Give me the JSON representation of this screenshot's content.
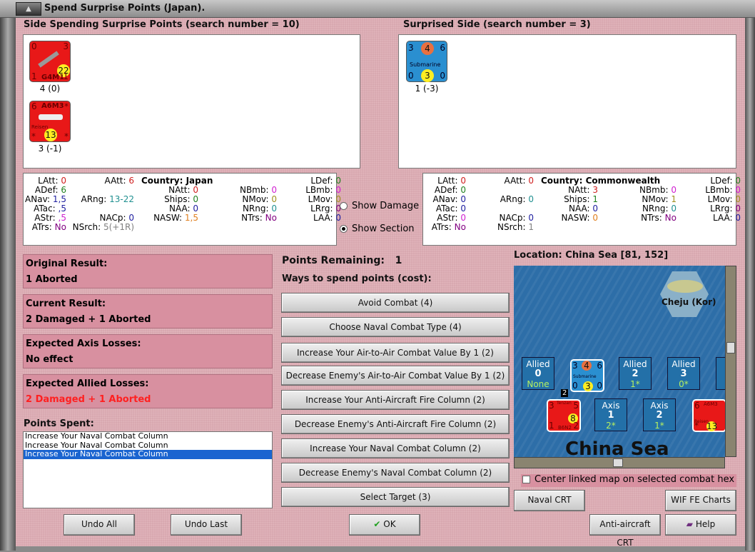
{
  "window": {
    "title": "Spend Surprise Points (Japan)."
  },
  "spending": {
    "header": "Side Spending Surprise Points (search number = 10)",
    "units": [
      {
        "name": "G4M1",
        "tl": "0",
        "tr": "3",
        "bl": "1",
        "br": "1",
        "range": "22",
        "caption": "4 (0)"
      },
      {
        "name": "A6M3",
        "sub": "Reisen",
        "tl": "6",
        "tr": "*",
        "bl": "*",
        "br": "*",
        "range": "13",
        "caption": "3 (-1)"
      }
    ]
  },
  "surprised": {
    "header": "Surprised Side (search number = 3)",
    "units": [
      {
        "name": "Submarine",
        "tl": "3",
        "top": "4",
        "tr": "6",
        "bl": "0",
        "bot": "3",
        "br": "0",
        "caption": "1 (-3)"
      }
    ]
  },
  "stats_left": {
    "country": "Country: Japan",
    "rows": [
      [
        [
          "LAtt:",
          "0",
          "#d02020"
        ],
        [
          "AAtt:",
          "6",
          "#d02020"
        ],
        null,
        null,
        null
      ],
      [
        [
          "LDef:",
          "0",
          "#208020"
        ],
        [
          "ADef:",
          "6",
          "#208020"
        ],
        null,
        [
          "NAtt:",
          "0",
          "#d02020"
        ],
        [
          "NBmb:",
          "0",
          "#d020d0"
        ]
      ],
      [
        [
          "LBmb:",
          "0",
          "#d020d0"
        ],
        [
          "ANav:",
          "1,5",
          "#2020a0"
        ],
        [
          "ARng:",
          "13-22",
          "#209090"
        ],
        [
          "Ships:",
          "0",
          "#208020"
        ],
        [
          "NMov:",
          "0",
          "#a09020"
        ]
      ],
      [
        [
          "LMov:",
          "0",
          "#a09020"
        ],
        [
          "ATac:",
          ",5",
          "#2020a0"
        ],
        null,
        [
          "NAA:",
          "0",
          "#2020a0"
        ],
        [
          "NRng:",
          "0",
          "#209090"
        ]
      ],
      [
        [
          "LRrg:",
          "0",
          "#800080"
        ],
        [
          "AStr:",
          ",5",
          "#d020d0"
        ],
        [
          "NACp:",
          "0",
          "#2020a0"
        ],
        [
          "NASW:",
          "1,5",
          "#e08020"
        ],
        [
          "NTrs:",
          "No",
          "#800080"
        ]
      ],
      [
        [
          "LAA:",
          "0",
          "#2020a0"
        ],
        [
          "ATrs:",
          "No",
          "#800080"
        ],
        [
          "NSrch:",
          "5(+1R)",
          "#808080"
        ],
        null,
        null
      ]
    ]
  },
  "stats_right": {
    "country": "Country: Commonwealth",
    "rows": [
      [
        [
          "LAtt:",
          "0",
          "#d02020"
        ],
        [
          "AAtt:",
          "0",
          "#d02020"
        ],
        null,
        null,
        null
      ],
      [
        [
          "LDef:",
          "0",
          "#208020"
        ],
        [
          "ADef:",
          "0",
          "#208020"
        ],
        null,
        [
          "NAtt:",
          "3",
          "#d02020"
        ],
        [
          "NBmb:",
          "0",
          "#d020d0"
        ]
      ],
      [
        [
          "LBmb:",
          "0",
          "#d020d0"
        ],
        [
          "ANav:",
          "0",
          "#2020a0"
        ],
        [
          "ARng:",
          "0",
          "#209090"
        ],
        [
          "Ships:",
          "1",
          "#208020"
        ],
        [
          "NMov:",
          "1",
          "#a09020"
        ]
      ],
      [
        [
          "LMov:",
          "0",
          "#a09020"
        ],
        [
          "ATac:",
          "0",
          "#2020a0"
        ],
        null,
        [
          "NAA:",
          "0",
          "#2020a0"
        ],
        [
          "NRng:",
          "0",
          "#209090"
        ]
      ],
      [
        [
          "LRrg:",
          "0",
          "#800080"
        ],
        [
          "AStr:",
          "0",
          "#d020d0"
        ],
        [
          "NACp:",
          "0",
          "#2020a0"
        ],
        [
          "NASW:",
          "0",
          "#e08020"
        ],
        [
          "NTrs:",
          "No",
          "#800080"
        ]
      ],
      [
        [
          "LAA:",
          "0",
          "#2020a0"
        ],
        [
          "ATrs:",
          "No",
          "#800080"
        ],
        [
          "NSrch:",
          "1",
          "#808080"
        ],
        null,
        null
      ]
    ]
  },
  "options": {
    "show_damage": "Show Damage",
    "show_section": "Show Section"
  },
  "results": {
    "original_label": "Original Result:",
    "original": "1 Aborted",
    "current_label": "Current Result:",
    "current": "2 Damaged + 1 Aborted",
    "axis_label": "Expected Axis Losses:",
    "axis": "No effect",
    "allied_label": "Expected Allied Losses:",
    "allied": "2 Damaged + 1 Aborted"
  },
  "points": {
    "remaining_label": "Points Remaining:",
    "remaining": "1",
    "ways_label": "Ways to spend points (cost):",
    "ways": [
      "Avoid Combat (4)",
      "Choose Naval Combat Type (4)",
      "Increase Your Air-to-Air Combat Value By 1 (2)",
      "Decrease Enemy's Air-to-Air Combat Value By 1 (2)",
      "Increase Your Anti-Aircraft Fire Column (2)",
      "Decrease Enemy's Anti-Aircraft Fire Column (2)",
      "Increase Your Naval Combat Column (2)",
      "Decrease Enemy's Naval Combat Column (2)",
      "Select Target (3)"
    ],
    "spent_label": "Points Spent:",
    "spent": [
      "Increase Your Naval Combat Column",
      "Increase Your Naval Combat Column",
      "Increase Your Naval Combat Column"
    ]
  },
  "map": {
    "location": "Location: China Sea [81, 152]",
    "sea": "China Sea",
    "island": "Cheju (Kor)",
    "boxes": [
      {
        "side": "Allied",
        "num": "0",
        "val": "None"
      },
      {
        "side": "Allied",
        "num": "2",
        "val": "1*"
      },
      {
        "side": "Allied",
        "num": "3",
        "val": "0*"
      },
      {
        "side": "Axis",
        "num": "1",
        "val": "2*"
      },
      {
        "side": "Axis",
        "num": "2",
        "val": "1*"
      }
    ],
    "sub": {
      "tl": "3",
      "top": "4",
      "tr": "6",
      "name": "Submarine",
      "bl": "0",
      "bot": "3",
      "br": "0"
    },
    "b6n2": {
      "top": "Tenzan",
      "tl": "3",
      "tr": "5",
      "range": "8",
      "bl": "1",
      "name": "B6N2",
      "br": "2",
      "stack": "2"
    },
    "a6m3": {
      "tl": "6",
      "name": "A6M3",
      "sub": "Reisen",
      "bl": "*",
      "range": "13"
    },
    "center_label": "Center linked map on selected combat hex"
  },
  "buttons": {
    "undo_all": "Undo All",
    "undo_last": "Undo Last",
    "ok": "OK",
    "naval_crt": "Naval CRT",
    "wif_charts": "WIF FE Charts",
    "aa_crt": "Anti-aircraft CRT",
    "help": "Help"
  }
}
